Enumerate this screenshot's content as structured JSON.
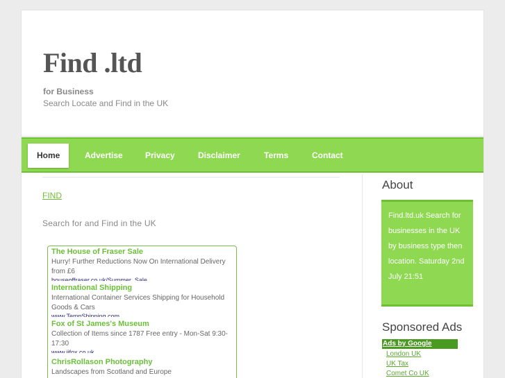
{
  "header": {
    "title": "Find .ltd",
    "tagline": "for Business",
    "description": "Search Locate and Find in the UK"
  },
  "nav": {
    "items": [
      {
        "label": "Home",
        "active": true
      },
      {
        "label": "Advertise"
      },
      {
        "label": "Privacy"
      },
      {
        "label": "Disclaimer"
      },
      {
        "label": "Terms"
      },
      {
        "label": "Contact"
      }
    ]
  },
  "main": {
    "link": "FIND",
    "text": "Search for and Find in the UK",
    "ads": [
      {
        "title": "The House of Fraser Sale",
        "desc": "Hurry! Further Reductions Now On International Delivery from £6",
        "url": "houseoffraser.co.uk/Summer_Sale"
      },
      {
        "title": "International Shipping",
        "desc": "International Container Services Shipping for Household Goods & Cars",
        "url": "www.TempShipping.com"
      },
      {
        "title": "Fox of St James's Museum",
        "desc": "Collection of Items since 1787 Free entry - Mon-Sat 9:30-17:30",
        "url": "www.jjfox.co.uk"
      },
      {
        "title": "ChrisRollason Photography",
        "desc": "Landscapes from Scotland and Europe",
        "url": ""
      }
    ]
  },
  "sidebar": {
    "about_heading": "About",
    "about_text": "Find.ltd.uk Search for businesses in the UK by business type then location. Saturday 2nd July 21:51",
    "ads_heading": "Sponsored Ads",
    "ads_by": "Ads by Google",
    "links": [
      "London UK",
      "UK Tax",
      "Comet Co UK"
    ]
  },
  "colors": {
    "accent": "#8ed951",
    "accent_dark": "#6fbf35",
    "text_muted": "#888888"
  }
}
